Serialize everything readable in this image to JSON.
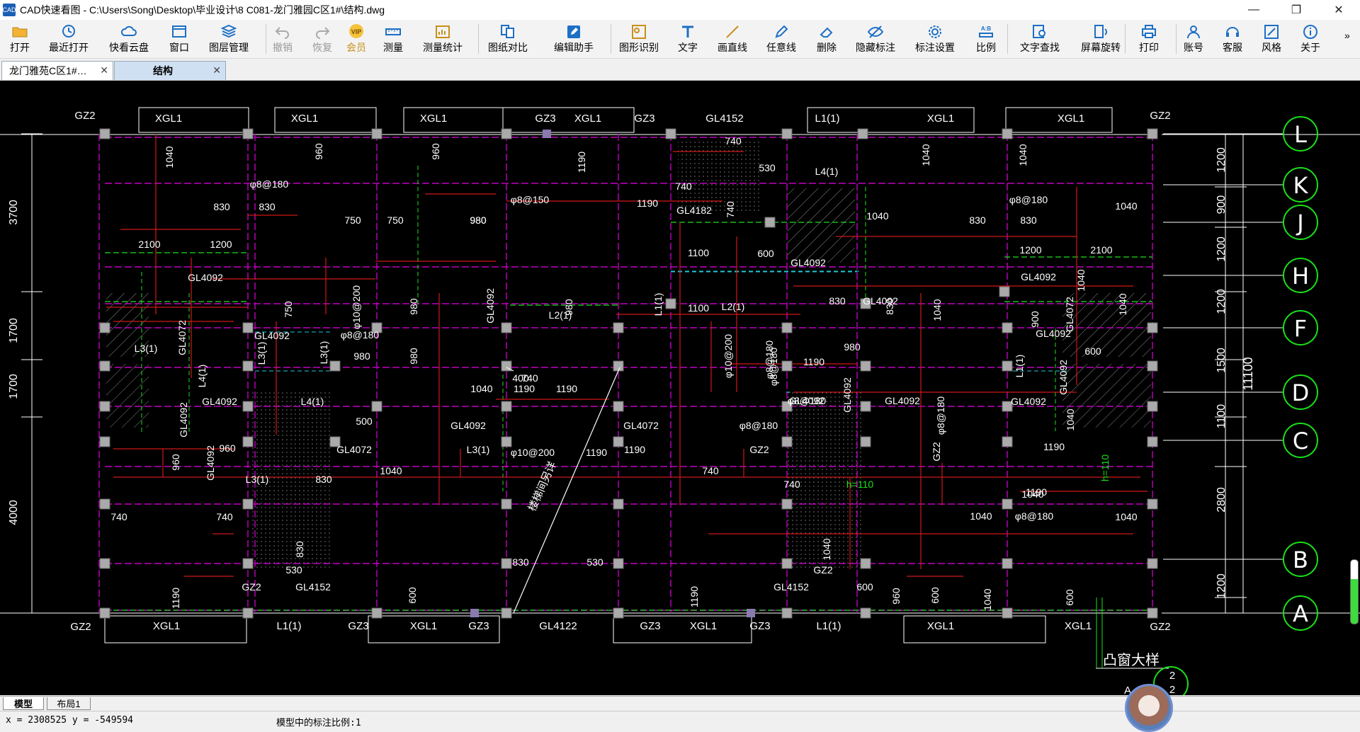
{
  "window": {
    "title": "CAD快速看图 - C:\\Users\\Song\\Desktop\\毕业设计\\8 C081-龙门雅园C区1#\\结构.dwg",
    "app_icon_text": "CAD",
    "controls": [
      "—",
      "❐",
      "✕"
    ]
  },
  "toolbar": {
    "items": [
      {
        "label": "打开",
        "icon": "folder-icon"
      },
      {
        "label": "最近打开",
        "icon": "clock-icon"
      },
      {
        "label": "快看云盘",
        "icon": "cloud-icon"
      },
      {
        "label": "窗口",
        "icon": "window-icon"
      },
      {
        "label": "图层管理",
        "icon": "layers-icon"
      },
      {
        "label": "撤销",
        "icon": "undo-icon"
      },
      {
        "label": "恢复",
        "icon": "redo-icon"
      },
      {
        "label": "会员",
        "icon": "vip-icon"
      },
      {
        "label": "测量",
        "icon": "ruler-icon"
      },
      {
        "label": "测量统计",
        "icon": "stats-icon"
      },
      {
        "label": "图纸对比",
        "icon": "compare-icon"
      },
      {
        "label": "编辑助手",
        "icon": "edit-icon"
      },
      {
        "label": "图形识别",
        "icon": "shape-icon"
      },
      {
        "label": "文字",
        "icon": "text-icon"
      },
      {
        "label": "画直线",
        "icon": "line-icon"
      },
      {
        "label": "任意线",
        "icon": "pen-icon"
      },
      {
        "label": "删除",
        "icon": "eraser-icon"
      },
      {
        "label": "隐藏标注",
        "icon": "hide-icon"
      },
      {
        "label": "标注设置",
        "icon": "gear-icon"
      },
      {
        "label": "比例",
        "icon": "scale-icon"
      },
      {
        "label": "文字查找",
        "icon": "find-icon"
      },
      {
        "label": "屏幕旋转",
        "icon": "rotate-icon"
      },
      {
        "label": "打印",
        "icon": "printer-icon"
      },
      {
        "label": "账号",
        "icon": "user-icon"
      },
      {
        "label": "客服",
        "icon": "headset-icon"
      },
      {
        "label": "风格",
        "icon": "style-icon"
      },
      {
        "label": "关于",
        "icon": "info-icon"
      }
    ],
    "vip_badge": "VIP",
    "scale_badge": "A:B",
    "more": "»"
  },
  "tabs": [
    {
      "label": "龙门雅苑C区1#…",
      "active": false
    },
    {
      "label": "结构",
      "active": true
    }
  ],
  "drawing": {
    "grid_labels": [
      "L",
      "K",
      "J",
      "H",
      "F",
      "D",
      "C",
      "B",
      "A"
    ],
    "right_dims": [
      "1200",
      "900",
      "1200",
      "1200",
      "1500",
      "1100",
      "2800",
      "1200"
    ],
    "total_dim": "11100",
    "left_dims": [
      "3700",
      "1700",
      "1700",
      "4000"
    ],
    "top_beams": [
      "XGL1",
      "XGL1",
      "XGL1",
      "GZ3",
      "XGL1",
      "GZ3",
      "GL4152",
      "L1(1)",
      "XGL1",
      "XGL1"
    ],
    "corner_labels": [
      "GZ2",
      "GZ2",
      "GZ2",
      "GZ2"
    ],
    "bottom_beams": [
      "XGL1",
      "L1(1)",
      "GZ3",
      "XGL1",
      "GZ3",
      "GL4122",
      "GZ3",
      "XGL1",
      "GZ3",
      "L1(1)",
      "XGL1",
      "XGL1"
    ],
    "white_texts": [
      "1040",
      "960",
      "960",
      "1190",
      "740",
      "530",
      "1040",
      "1040",
      "φ8@180",
      "830",
      "830",
      "φ8@150",
      "980",
      "1190",
      "750",
      "750",
      "980",
      "740",
      "GL4182",
      "740",
      "L4(1)",
      "1040",
      "830",
      "φ8@180",
      "830",
      "1040",
      "2100",
      "1200",
      "1200",
      "2100",
      "GL4092",
      "1040",
      "1100",
      "600",
      "GL4092",
      "GL4092",
      "1040",
      "750",
      "φ10@200",
      "980",
      "GL4092",
      "980",
      "L1(1)",
      "L2(1)",
      "1100",
      "L2(1)",
      "830",
      "GL4092",
      "830",
      "1040",
      "900",
      "GL4072",
      "GL4092",
      "GL4072",
      "GL4092",
      "φ8@180",
      "L3(1)",
      "L3(1)",
      "980",
      "980",
      "φ10@200",
      "980",
      "1190",
      "φ8@180",
      "L1(1)",
      "600",
      "L3(1)",
      "L4(1)",
      "GL4092",
      "L4(1)",
      "400",
      "GL4092",
      "GL4092",
      "GL4092",
      "GL4092",
      "GL4092",
      "740",
      "GL4092",
      "500",
      "GL4092",
      "GL4072",
      "φ8@180",
      "φ8@180",
      "φ8@180",
      "φ8@180",
      "1040",
      "960",
      "GL4092",
      "GL4072",
      "L3(1)",
      "φ10@200",
      "1190",
      "1190",
      "GZ2",
      "GZ2",
      "1190",
      "1190",
      "960",
      "L3(1)",
      "830",
      "1040",
      "740",
      "740",
      "h=110",
      "h=110",
      "740",
      "740",
      "1040",
      "1040",
      "1040",
      "φ8@180",
      "830",
      "1040",
      "830",
      "530",
      "530",
      "GZ2",
      "GZ2",
      "GL4152",
      "GL4152",
      "600",
      "600",
      "600",
      "600",
      "1190",
      "1190",
      "960",
      "1040",
      "1040",
      "1190",
      "1190"
    ],
    "slope_text": "楼梯间另详",
    "detail_title": "凸窗大样",
    "detail_nums": [
      "2",
      "2"
    ],
    "detail_ref": "A"
  },
  "layout_tabs": [
    {
      "label": "模型",
      "active": true
    },
    {
      "label": "布局1",
      "active": false
    }
  ],
  "status": {
    "coords": "x = 2308525  y = -549594",
    "message": "模型中的标注比例:1"
  },
  "colors": {
    "canvas": "#000000",
    "grid_bubble": "#33ee33",
    "beam_magenta": "#c000c0",
    "rebar_red": "#d01818",
    "green_text": "#19e019",
    "dim_white": "#ffffff"
  }
}
